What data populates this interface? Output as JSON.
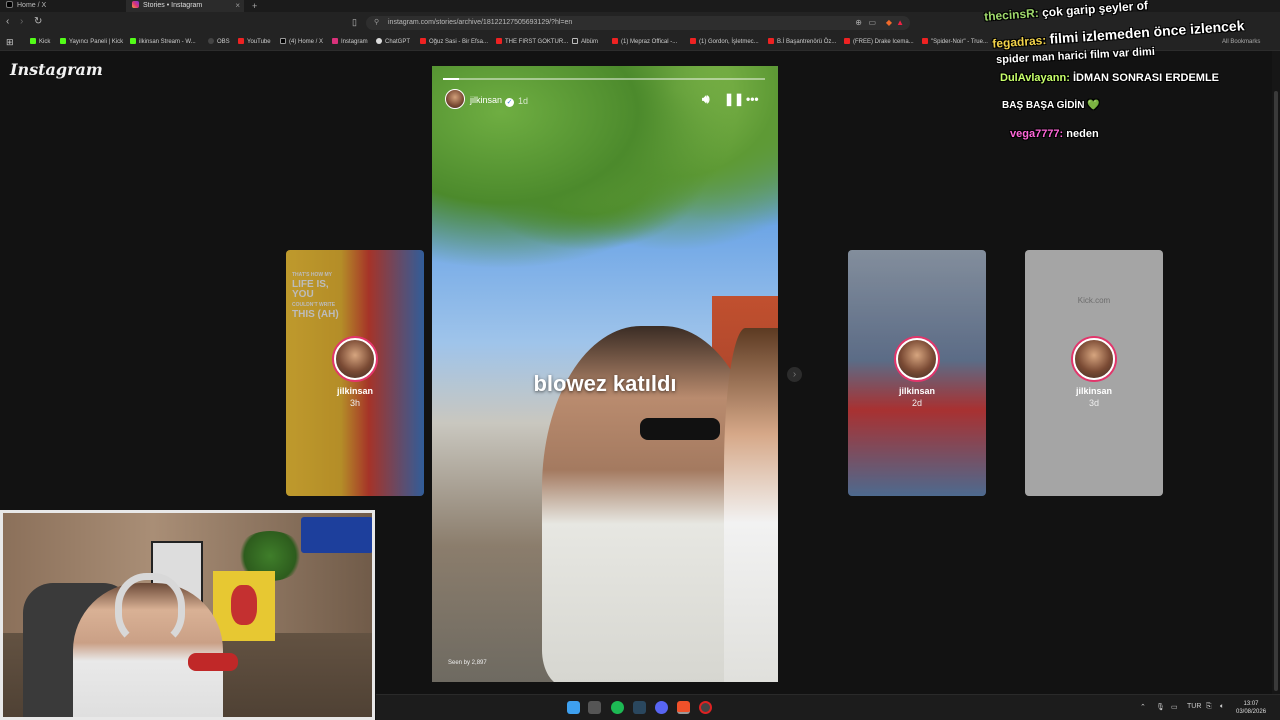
{
  "tabs": [
    {
      "label": "Home / X",
      "active": false
    },
    {
      "label": "Stories • Instagram",
      "active": true
    }
  ],
  "new_tab_icon": "plus-icon",
  "url": "instagram.com/stories/archive/18122127505693129/?hl=en",
  "bookmarks": [
    "Kick",
    "Yayıncı Paneli | Kick",
    "ilkinsan Stream - W...",
    "OBS",
    "YouTube",
    "(4) Home / X",
    "Instagram",
    "ChatGPT",
    "Oğuz Sasi - Bir Efsa...",
    "THE FIRST GOKTUR...",
    "Albüm",
    "(1) Mepraz Offical -...",
    "(1) Gordon, İşletmec...",
    "B.İ Başantrenörü Öz...",
    "(FREE) Drake Icema...",
    "\"Spider-Noir\" - True..."
  ],
  "all_bookmarks": "All Bookmarks",
  "instagram": {
    "logo": "Instagram",
    "story": {
      "username": "jilkinsan",
      "time": "1d",
      "caption": "blowez katıldı",
      "seen": "Seen by 2,897",
      "progress": 0.05
    },
    "cards": [
      {
        "username": "jilkinsan",
        "time": "3h",
        "poster_lines": [
          "THAT'S HOW MY",
          "LIFE IS,",
          "YOU",
          "COULDN'T WRITE",
          "THIS (AH)"
        ]
      },
      {
        "username": "jilkinsan",
        "time": "2d"
      },
      {
        "username": "jilkinsan",
        "time": "3d",
        "site": "Kick.com"
      }
    ]
  },
  "chat": [
    {
      "user": "thecinsR:",
      "text": "çok garip şeyler of"
    },
    {
      "user": "fegadras:",
      "text": "filmi izlemeden önce izlencek",
      "text2": "spider man harici film var dimi"
    },
    {
      "user": "DulAvlayann:",
      "text": "İDMAN SONRASI ERDEMLE",
      "text2": "BAŞ BAŞA GİDİN 💚"
    },
    {
      "user": "vega7777:",
      "text": "neden"
    }
  ],
  "taskbar": {
    "lang": "TUR",
    "time": "13:07",
    "date": "03/08/2026"
  },
  "colors": {
    "bg": "#121212",
    "accent": "#e2356b",
    "chat_user1": "#9ed86b",
    "chat_user4": "#ff67d9"
  }
}
